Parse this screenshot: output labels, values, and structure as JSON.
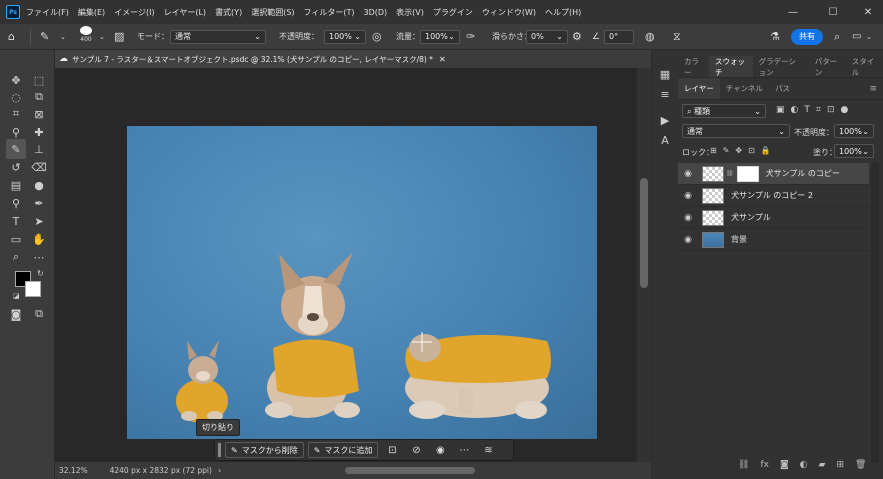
{
  "menubar": {
    "logo": "Ps",
    "items": [
      "ファイル(F)",
      "編集(E)",
      "イメージ(I)",
      "レイヤー(L)",
      "書式(Y)",
      "選択範囲(S)",
      "フィルター(T)",
      "3D(D)",
      "表示(V)",
      "プラグイン",
      "ウィンドウ(W)",
      "ヘルプ(H)"
    ]
  },
  "options": {
    "brush_size": "400",
    "mode_label": "モード：",
    "mode_value": "通常",
    "opacity_label": "不透明度：",
    "opacity_value": "100%",
    "flow_label": "流量：",
    "flow_value": "100%",
    "smoothing_label": "滑らかさ：",
    "smoothing_value": "0%",
    "angle_value": "0°",
    "share_label": "共有"
  },
  "document": {
    "tab_title": "サンプル 7 - ラスター＆スマートオブジェクト.psdc @ 32.1% (犬サンプル のコピー, レイヤーマスク/8) *"
  },
  "status": {
    "zoom": "32.12%",
    "dimensions": "4240 px x 2832 px (72 ppi)"
  },
  "context_bar": {
    "tooltip": "切り貼り",
    "remove_mask_label": "マスクから削除",
    "add_mask_label": "マスクに追加"
  },
  "panel_top_tabs": [
    "カラー",
    "スウォッチ",
    "グラデーション",
    "パターン",
    "スタイル"
  ],
  "layers_panel": {
    "tabs": [
      "レイヤー",
      "チャンネル",
      "パス"
    ],
    "filter_value": "種類",
    "blend_mode": "通常",
    "opacity_label": "不透明度：",
    "opacity_value": "100%",
    "lock_label": "ロック：",
    "fill_label": "塗り：",
    "fill_value": "100%",
    "layers": [
      {
        "name": "犬サンプル のコピー"
      },
      {
        "name": "犬サンプル のコピー 2"
      },
      {
        "name": "犬サンプル"
      },
      {
        "name": "背景"
      }
    ]
  },
  "colors": {
    "accent": "#1473e6",
    "canvas_blue": "#4682b2",
    "shirt_yellow": "#e0a52a"
  }
}
